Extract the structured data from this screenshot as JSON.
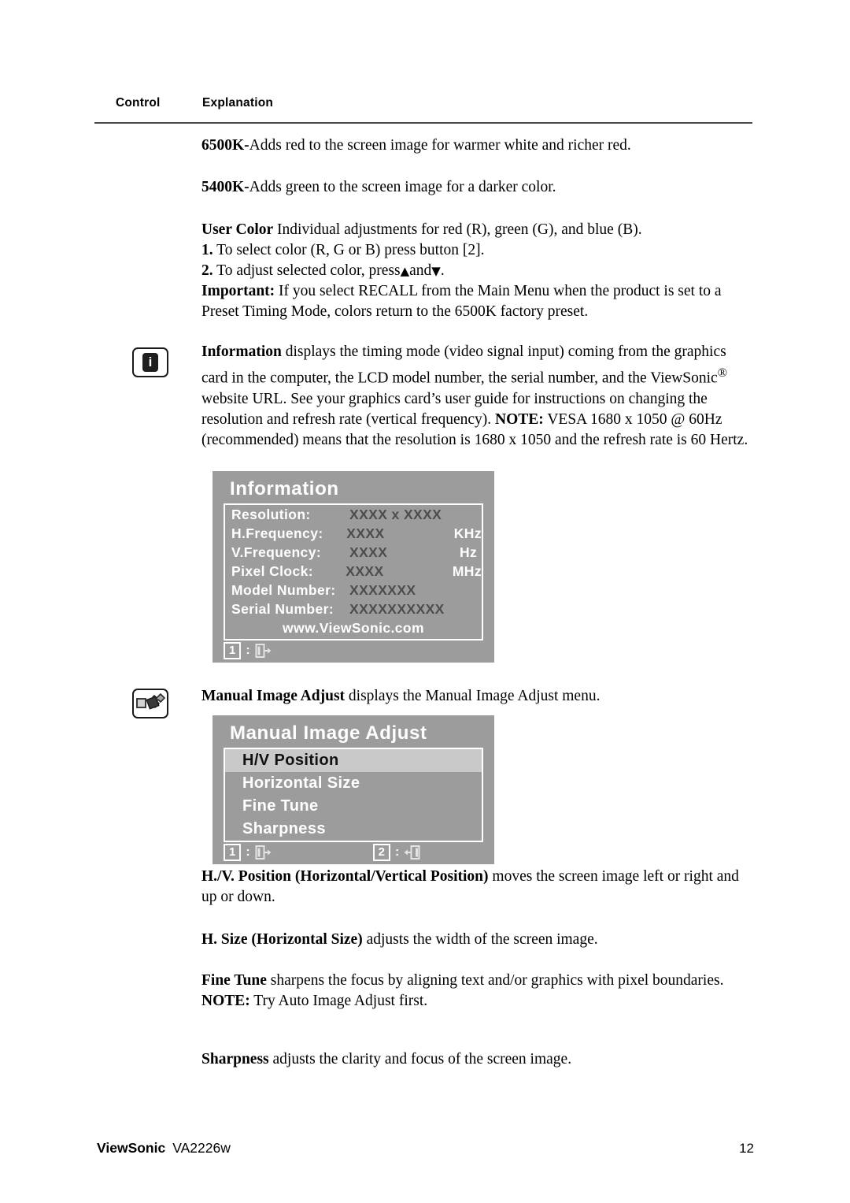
{
  "header": {
    "control_label": "Control",
    "explanation_label": "Explanation"
  },
  "body": {
    "p_6500k_bold": "6500K-",
    "p_6500k_rest": "Adds red to the screen image for warmer white and richer red.",
    "p_5400k_bold": "5400K-",
    "p_5400k_rest": "Adds green to the screen image for a darker color.",
    "user_color_bold": "User Color",
    "user_color_rest": "  Individual adjustments for red (R), green (G),  and blue (B).",
    "user_color_step1_num": "1.",
    "user_color_step1": " To select color (R, G or B) press button [2].",
    "user_color_step2_num": "2.",
    "user_color_step2_a": " To adjust selected color, press",
    "user_color_step2_up": "▲",
    "user_color_step2_b": "and",
    "user_color_step2_down": "▼",
    "user_color_step2_c": ".",
    "user_color_important_bold": "Important:",
    "user_color_important_rest": " If you select RECALL from the Main Menu when the product is set to a Preset Timing Mode, colors return to the 6500K factory preset.",
    "information_bold": "Information",
    "information_rest": " displays the timing mode (video signal input) coming from the graphics card in the computer, the LCD model number, the serial number, and the ViewSonic",
    "information_reg": "®",
    "information_rest2": " website URL. See your graphics card’s user guide for instructions on changing the resolution and refresh rate (vertical frequency).",
    "information_note_bold": "NOTE:",
    "information_note_rest": " VESA 1680 x 1050 @ 60Hz (recommended) means that the resolution is 1680 x 1050 and the refresh rate is 60 Hertz.",
    "manual_bold": "Manual Image Adjust",
    "manual_rest": " displays the Manual Image Adjust menu.",
    "hv_bold": "H./V. Position (Horizontal/Vertical Position)",
    "hv_rest": " moves the screen image left or right and up or down.",
    "hsize_bold": "H. Size (Horizontal Size)",
    "hsize_rest": " adjusts the width of the screen image.",
    "finetune_bold": "Fine Tune",
    "finetune_rest": " sharpens the focus by aligning text and/or graphics with pixel boundaries.",
    "finetune_note_bold": "NOTE:",
    "finetune_note_rest": " Try Auto Image Adjust first.",
    "sharpness_bold": "Sharpness",
    "sharpness_rest": " adjusts the clarity and focus of the screen image."
  },
  "icons": {
    "info_letter": "i"
  },
  "osd_information": {
    "title": "Information",
    "rows": [
      {
        "label": "Resolution:",
        "value": "XXXX x XXXX",
        "unit": ""
      },
      {
        "label": "H.Frequency:",
        "value": "XXXX",
        "unit": "KHz"
      },
      {
        "label": "V.Frequency:",
        "value": "XXXX",
        "unit": "Hz"
      },
      {
        "label": "Pixel Clock:",
        "value": "XXXX",
        "unit": "MHz"
      }
    ],
    "model_label": "Model Number:",
    "model_value": "XXXXXXX",
    "serial_label": "Serial Number:",
    "serial_value": "XXXXXXXXXX",
    "website": "www.ViewSonic.com",
    "status": {
      "key1": "1",
      "colon": ":"
    }
  },
  "osd_manual_image_adjust": {
    "title": "Manual Image Adjust",
    "items": [
      {
        "label": "H/V Position",
        "selected": true
      },
      {
        "label": "Horizontal Size",
        "selected": false
      },
      {
        "label": "Fine Tune",
        "selected": false
      },
      {
        "label": "Sharpness",
        "selected": false
      }
    ],
    "status": {
      "key1": "1",
      "key2": "2",
      "colon": ":"
    }
  },
  "footer": {
    "brand": "ViewSonic",
    "model": "VA2226w",
    "page_number": "12"
  },
  "colors": {
    "osd_background": "#9c9c9c",
    "osd_highlight": "#c9c9c9",
    "osd_label": "#ffffff",
    "osd_value": "#4d4d4d",
    "rule": "#4a4a4a"
  }
}
